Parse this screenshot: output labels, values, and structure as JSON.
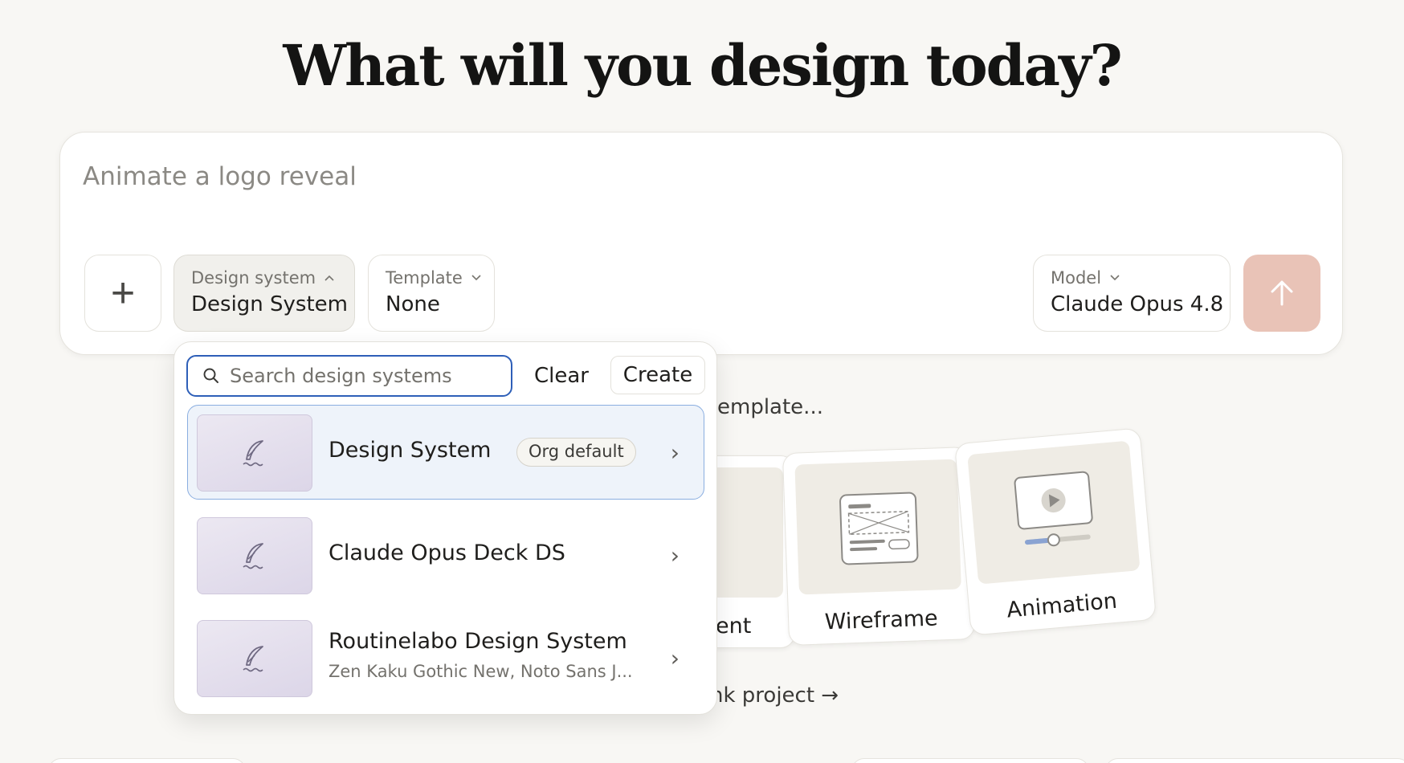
{
  "hero": {
    "title": "What will you design today?"
  },
  "composer": {
    "placeholder": "Animate a logo reveal",
    "add_label": "+",
    "design_system": {
      "label": "Design system",
      "value": "Design System"
    },
    "template": {
      "label": "Template",
      "value": "None"
    },
    "model": {
      "label": "Model",
      "value": "Claude Opus 4.8"
    },
    "send_glyph": "↑"
  },
  "background": {
    "template_prompt_fragment": "emplate...",
    "blank_project_fragment": "nk project →",
    "cards": [
      {
        "label": "ent"
      },
      {
        "label": "Wireframe"
      },
      {
        "label": "Animation"
      }
    ]
  },
  "dropdown": {
    "search_placeholder": "Search design systems",
    "clear_label": "Clear",
    "create_label": "Create",
    "items": [
      {
        "name": "Design System",
        "badge": "Org default",
        "subtitle": ""
      },
      {
        "name": "Claude Opus Deck DS",
        "badge": "",
        "subtitle": ""
      },
      {
        "name": "Routinelabo Design System",
        "badge": "",
        "subtitle": "Zen Kaku Gothic New, Noto Sans J..."
      }
    ],
    "chevron": "›"
  },
  "colors": {
    "background": "#f8f7f4",
    "send_button": "#e9c3b7",
    "search_focus": "#2e5fb8",
    "selected_item_bg": "#eef3fa",
    "selected_item_border": "#8aaee0"
  }
}
